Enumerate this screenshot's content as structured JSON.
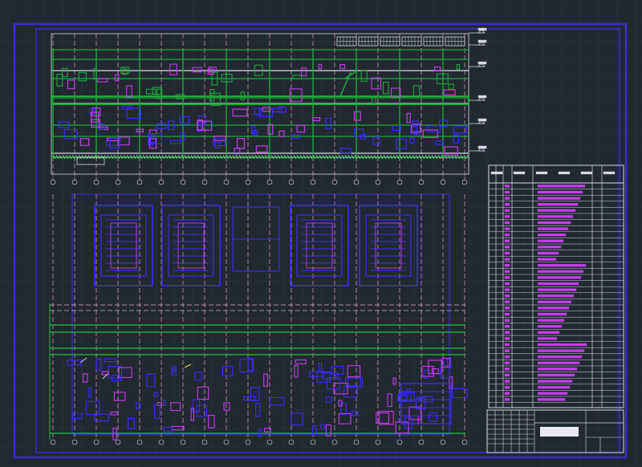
{
  "drawing": {
    "background": "#212830",
    "grid_color": "#2b3440",
    "frame_color": "#3b2bd8",
    "line_white": "#d8d8e8",
    "line_green": "#1faa3a",
    "line_magenta": "#c83cf0",
    "line_blue": "#3a2cff",
    "line_pink": "#e6a6c8",
    "line_yellow": "#e8d84a"
  },
  "section_view": {
    "elevation_marks": 6,
    "axis_count": 20,
    "ladder_panels": 6
  },
  "plan_view": {
    "axis_count": 20,
    "equipment_blocks": 4
  },
  "spec_table": {
    "header_cells": 6,
    "rows": 36
  },
  "title_block": {
    "scale_note": "",
    "stamp": ""
  }
}
